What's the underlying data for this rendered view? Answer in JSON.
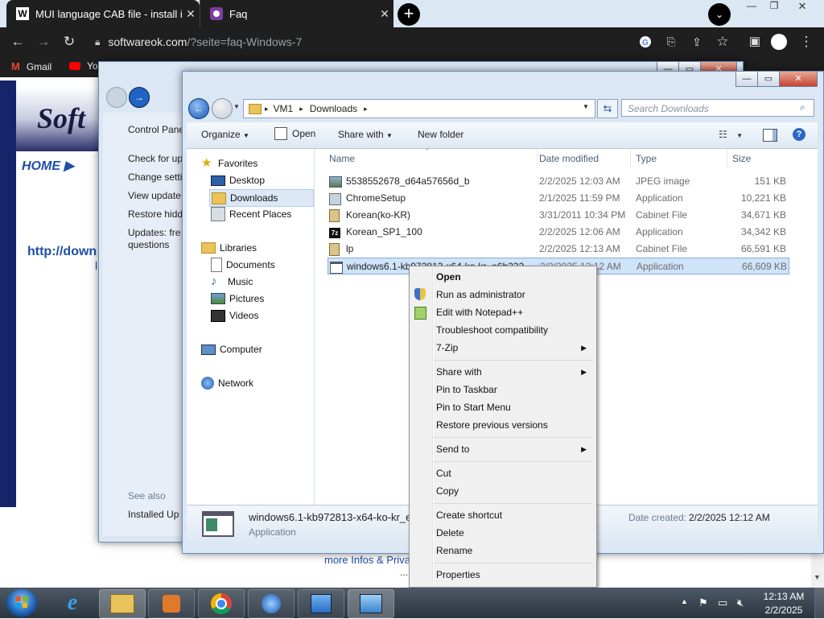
{
  "browser": {
    "tabs": [
      {
        "title": "MUI language CAB file - install in",
        "favicon": "W",
        "active": true
      },
      {
        "title": "Faq",
        "favicon": "faq-icon",
        "active": false
      }
    ],
    "url_domain": "softwareok.com",
    "url_path": "/?seite=faq-Windows-7",
    "bookmarks": [
      "Gmail",
      "Yo"
    ]
  },
  "site": {
    "logo_text": "Soft",
    "home_label": "HOME ▶",
    "link_text": "http://down",
    "footer_text": "more Infos & Priva",
    "footer_dots": "...",
    "letter_l": "l"
  },
  "control_panel": {
    "breadcrumb": "Control Pane",
    "links": [
      "Check for up",
      "Change setti",
      "View update",
      "Restore hidd",
      "Updates: fre",
      "questions"
    ],
    "see_also": "See also",
    "installed": "Installed Up"
  },
  "explorer": {
    "breadcrumb": [
      "VM1",
      "Downloads"
    ],
    "search_placeholder": "Search Downloads",
    "toolbar": {
      "organize": "Organize",
      "open": "Open",
      "share_with": "Share with",
      "new_folder": "New folder"
    },
    "nav": {
      "favorites": "Favorites",
      "desktop": "Desktop",
      "downloads": "Downloads",
      "recent": "Recent Places",
      "libraries": "Libraries",
      "documents": "Documents",
      "music": "Music",
      "pictures": "Pictures",
      "videos": "Videos",
      "computer": "Computer",
      "network": "Network"
    },
    "columns": {
      "name": "Name",
      "date": "Date modified",
      "type": "Type",
      "size": "Size"
    },
    "files": [
      {
        "name": "5538552678_d64a57656d_b",
        "date": "2/2/2025 12:03 AM",
        "type": "JPEG image",
        "size": "151 KB"
      },
      {
        "name": "ChromeSetup",
        "date": "2/1/2025 11:59 PM",
        "type": "Application",
        "size": "10,221 KB"
      },
      {
        "name": "Korean(ko-KR)",
        "date": "3/31/2011 10:34 PM",
        "type": "Cabinet File",
        "size": "34,671 KB"
      },
      {
        "name": "Korean_SP1_100",
        "date": "2/2/2025 12:06 AM",
        "type": "Application",
        "size": "34,342 KB"
      },
      {
        "name": "lp",
        "date": "2/2/2025 12:13 AM",
        "type": "Cabinet File",
        "size": "66,591 KB"
      },
      {
        "name": "windows6.1-kb972813-x64-ko-kr_e6b232",
        "date": "2/2/2025 12:12 AM",
        "type": "Application",
        "size": "66,609 KB"
      }
    ],
    "details": {
      "name": "windows6.1-kb972813-x64-ko-kr_e",
      "type": "Application",
      "date_label": "Date created:",
      "date_value": "2/2/2025 12:12 AM"
    }
  },
  "context_menu": {
    "items": [
      "Open",
      "Run as administrator",
      "Edit with Notepad++",
      "Troubleshoot compatibility",
      "7-Zip",
      "Share with",
      "Pin to Taskbar",
      "Pin to Start Menu",
      "Restore previous versions",
      "Send to",
      "Cut",
      "Copy",
      "Create shortcut",
      "Delete",
      "Rename",
      "Properties"
    ]
  },
  "taskbar": {
    "time": "12:13 AM",
    "date": "2/2/2025"
  }
}
